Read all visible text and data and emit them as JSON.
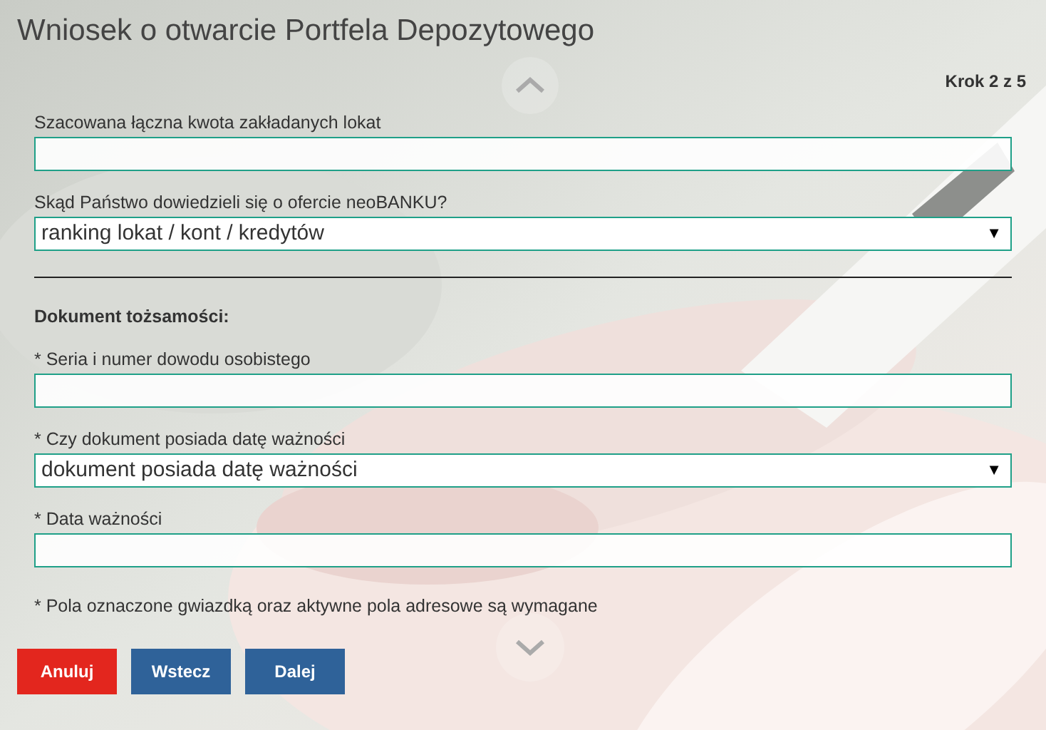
{
  "title": "Wniosek o otwarcie Portfela Depozytowego",
  "step": "Krok 2 z 5",
  "groups": [
    {
      "fields": [
        {
          "kind": "text",
          "label": "Szacowana łączna kwota zakładanych lokat"
        },
        {
          "kind": "select",
          "label": "Skąd Państwo dowiedzieli się o ofercie neoBANKU?",
          "value": "ranking lokat / kont / kredytów",
          "arrow": "▼"
        }
      ]
    },
    {
      "heading": "Dokument tożsamości:",
      "fields": [
        {
          "kind": "text",
          "label": "* Seria i numer dowodu osobistego"
        },
        {
          "kind": "select",
          "label": "* Czy dokument posiada datę ważności",
          "value": "dokument posiada datę ważności",
          "arrow": "▼"
        },
        {
          "kind": "text",
          "label": "* Data ważności"
        }
      ]
    }
  ],
  "note": "* Pola oznaczone gwiazdką oraz aktywne pola adresowe są wymagane",
  "buttons": [
    {
      "kind": "danger",
      "label": "Anuluj"
    },
    {
      "kind": "primary",
      "label": "Wstecz"
    },
    {
      "kind": "primary",
      "label": "Dalej"
    }
  ]
}
